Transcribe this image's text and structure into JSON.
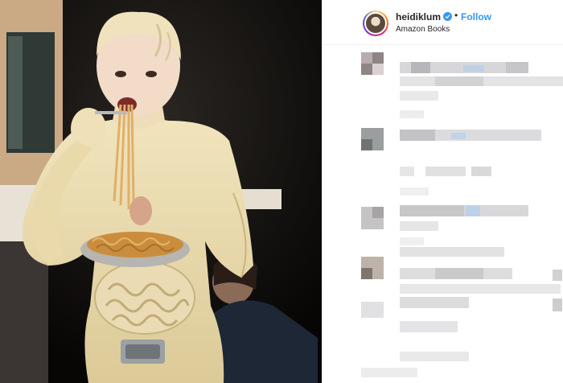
{
  "post": {
    "author": {
      "username": "heidiklum",
      "verified": true,
      "follow_label": "Follow",
      "separator": "•",
      "location": "Amazon Books"
    },
    "photo": {
      "description_icon": "costume-photo"
    },
    "comments_censored": true
  },
  "colors": {
    "link_blue": "#3897f0",
    "text": "#262626",
    "divider": "#efefef"
  }
}
